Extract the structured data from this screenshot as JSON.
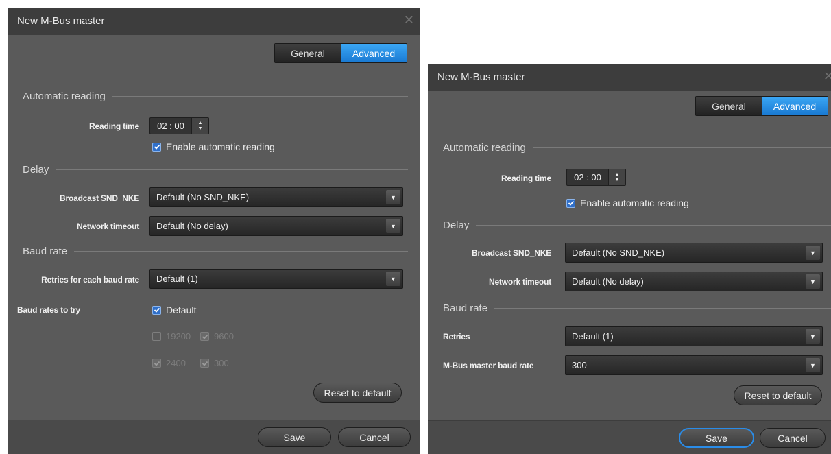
{
  "dialog_a": {
    "title": "New M-Bus master",
    "tabs": {
      "general": "General",
      "advanced": "Advanced"
    },
    "auto_reading": {
      "heading": "Automatic reading",
      "reading_time_label": "Reading time",
      "reading_time_value": "02 : 00",
      "enable_label": "Enable automatic reading"
    },
    "delay": {
      "heading": "Delay",
      "broadcast_label": "Broadcast SND_NKE",
      "broadcast_value": "Default (No SND_NKE)",
      "timeout_label": "Network timeout",
      "timeout_value": "Default (No delay)"
    },
    "baud": {
      "heading": "Baud rate",
      "retries_label": "Retries for each baud rate",
      "retries_value": "Default (1)",
      "rates_label": "Baud rates to try",
      "default_option": "Default",
      "rate_19200": "19200",
      "rate_9600": "9600",
      "rate_2400": "2400",
      "rate_300": "300"
    },
    "reset_label": "Reset to default",
    "save_label": "Save",
    "cancel_label": "Cancel"
  },
  "dialog_b": {
    "title": "New M-Bus master",
    "tabs": {
      "general": "General",
      "advanced": "Advanced"
    },
    "auto_reading": {
      "heading": "Automatic reading",
      "reading_time_label": "Reading time",
      "reading_time_value": "02 : 00",
      "enable_label": "Enable automatic reading"
    },
    "delay": {
      "heading": "Delay",
      "broadcast_label": "Broadcast SND_NKE",
      "broadcast_value": "Default (No SND_NKE)",
      "timeout_label": "Network timeout",
      "timeout_value": "Default (No delay)"
    },
    "baud": {
      "heading": "Baud rate",
      "retries_label": "Retries",
      "retries_value": "Default (1)",
      "master_baud_label": "M-Bus master baud rate",
      "master_baud_value": "300"
    },
    "reset_label": "Reset to default",
    "save_label": "Save",
    "cancel_label": "Cancel"
  },
  "icons": {
    "close": "close-icon",
    "dropdown": "chevron-down-icon",
    "spinner": "spinner-arrows-icon",
    "check": "checkmark-icon"
  },
  "colors": {
    "accent": "#2a8ce8",
    "dialog_bg": "#5a5a5a",
    "titlebar_bg": "#3d3d3d"
  }
}
